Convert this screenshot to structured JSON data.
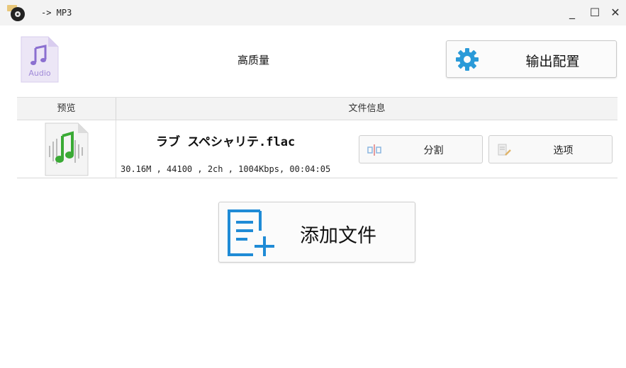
{
  "window": {
    "title": "-> MP3",
    "minimize_glyph": "_",
    "maximize_glyph": "☐",
    "close_glyph": "✕"
  },
  "format": {
    "icon_name": "audio-format-icon",
    "badge_text": "Audio"
  },
  "quality_label": "高质量",
  "output_config": {
    "label": "输出配置",
    "icon_name": "gear-icon",
    "icon_color": "#2a9ad8"
  },
  "table": {
    "headers": {
      "preview": "预览",
      "info": "文件信息"
    },
    "rows": [
      {
        "filename": "ラブ スペシャリテ.flac",
        "info": "30.16M , 44100 , 2ch , 1004Kbps, 00:04:05",
        "split_label": "分割",
        "options_label": "选项"
      }
    ]
  },
  "add_file": {
    "label": "添加文件",
    "icon_name": "add-file-icon",
    "icon_color": "#1f8bd6"
  }
}
